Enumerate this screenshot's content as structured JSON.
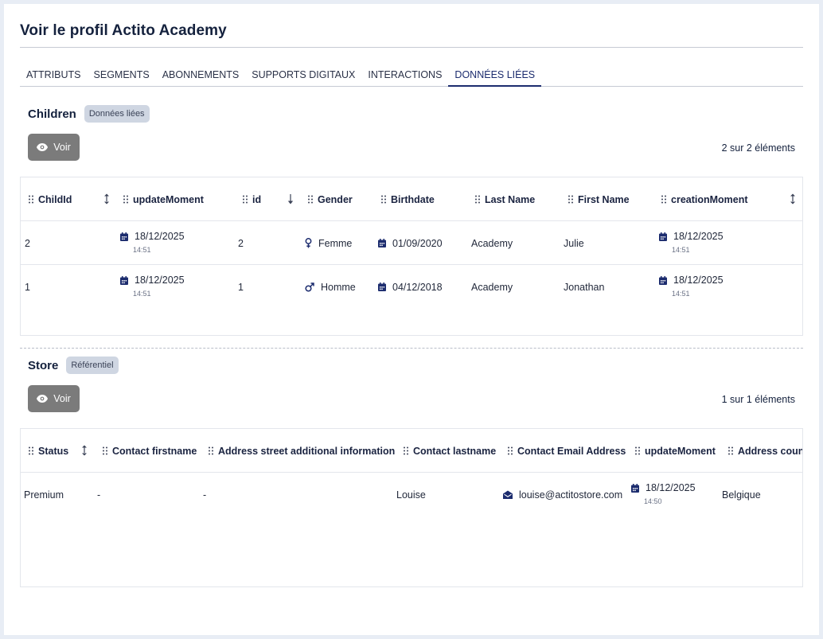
{
  "page": {
    "title": "Voir le profil Actito Academy"
  },
  "tabs": [
    {
      "label": "ATTRIBUTS",
      "active": false
    },
    {
      "label": "SEGMENTS",
      "active": false
    },
    {
      "label": "ABONNEMENTS",
      "active": false
    },
    {
      "label": "SUPPORTS DIGITAUX",
      "active": false
    },
    {
      "label": "INTERACTIONS",
      "active": false
    },
    {
      "label": "DONNÉES LIÉES",
      "active": true
    }
  ],
  "children": {
    "title": "Children",
    "badge": "Données liées",
    "voir_label": "Voir",
    "count": "2 sur 2 éléments",
    "columns": [
      "ChildId",
      "updateMoment",
      "id",
      "Gender",
      "Birthdate",
      "Last Name",
      "First Name",
      "creationMoment"
    ],
    "rows": [
      {
        "childId": "2",
        "updateDate": "18/12/2025",
        "updateTime": "14:51",
        "id": "2",
        "gender": "Femme",
        "genderIcon": "female-icon",
        "birthdate": "01/09/2020",
        "lastName": "Academy",
        "firstName": "Julie",
        "creationDate": "18/12/2025",
        "creationTime": "14:51"
      },
      {
        "childId": "1",
        "updateDate": "18/12/2025",
        "updateTime": "14:51",
        "id": "1",
        "gender": "Homme",
        "genderIcon": "male-icon",
        "birthdate": "04/12/2018",
        "lastName": "Academy",
        "firstName": "Jonathan",
        "creationDate": "18/12/2025",
        "creationTime": "14:51"
      }
    ]
  },
  "store": {
    "title": "Store",
    "badge": "Référentiel",
    "voir_label": "Voir",
    "count": "1 sur 1 éléments",
    "columns": [
      "Status",
      "Contact firstname",
      "Address street additional information",
      "Contact lastname",
      "Contact Email Address",
      "updateMoment",
      "Address coun"
    ],
    "rows": [
      {
        "status": "Premium",
        "firstname": "-",
        "streetAdditional": "-",
        "lastname": "Louise",
        "email": "louise@actitostore.com",
        "updateDate": "18/12/2025",
        "updateTime": "14:50",
        "country": "Belgique"
      }
    ]
  },
  "colors": {
    "accent": "#1c2c6e",
    "button": "#7b7b7b",
    "badge": "#cfd6e2",
    "icon": "#1c2c6e"
  }
}
